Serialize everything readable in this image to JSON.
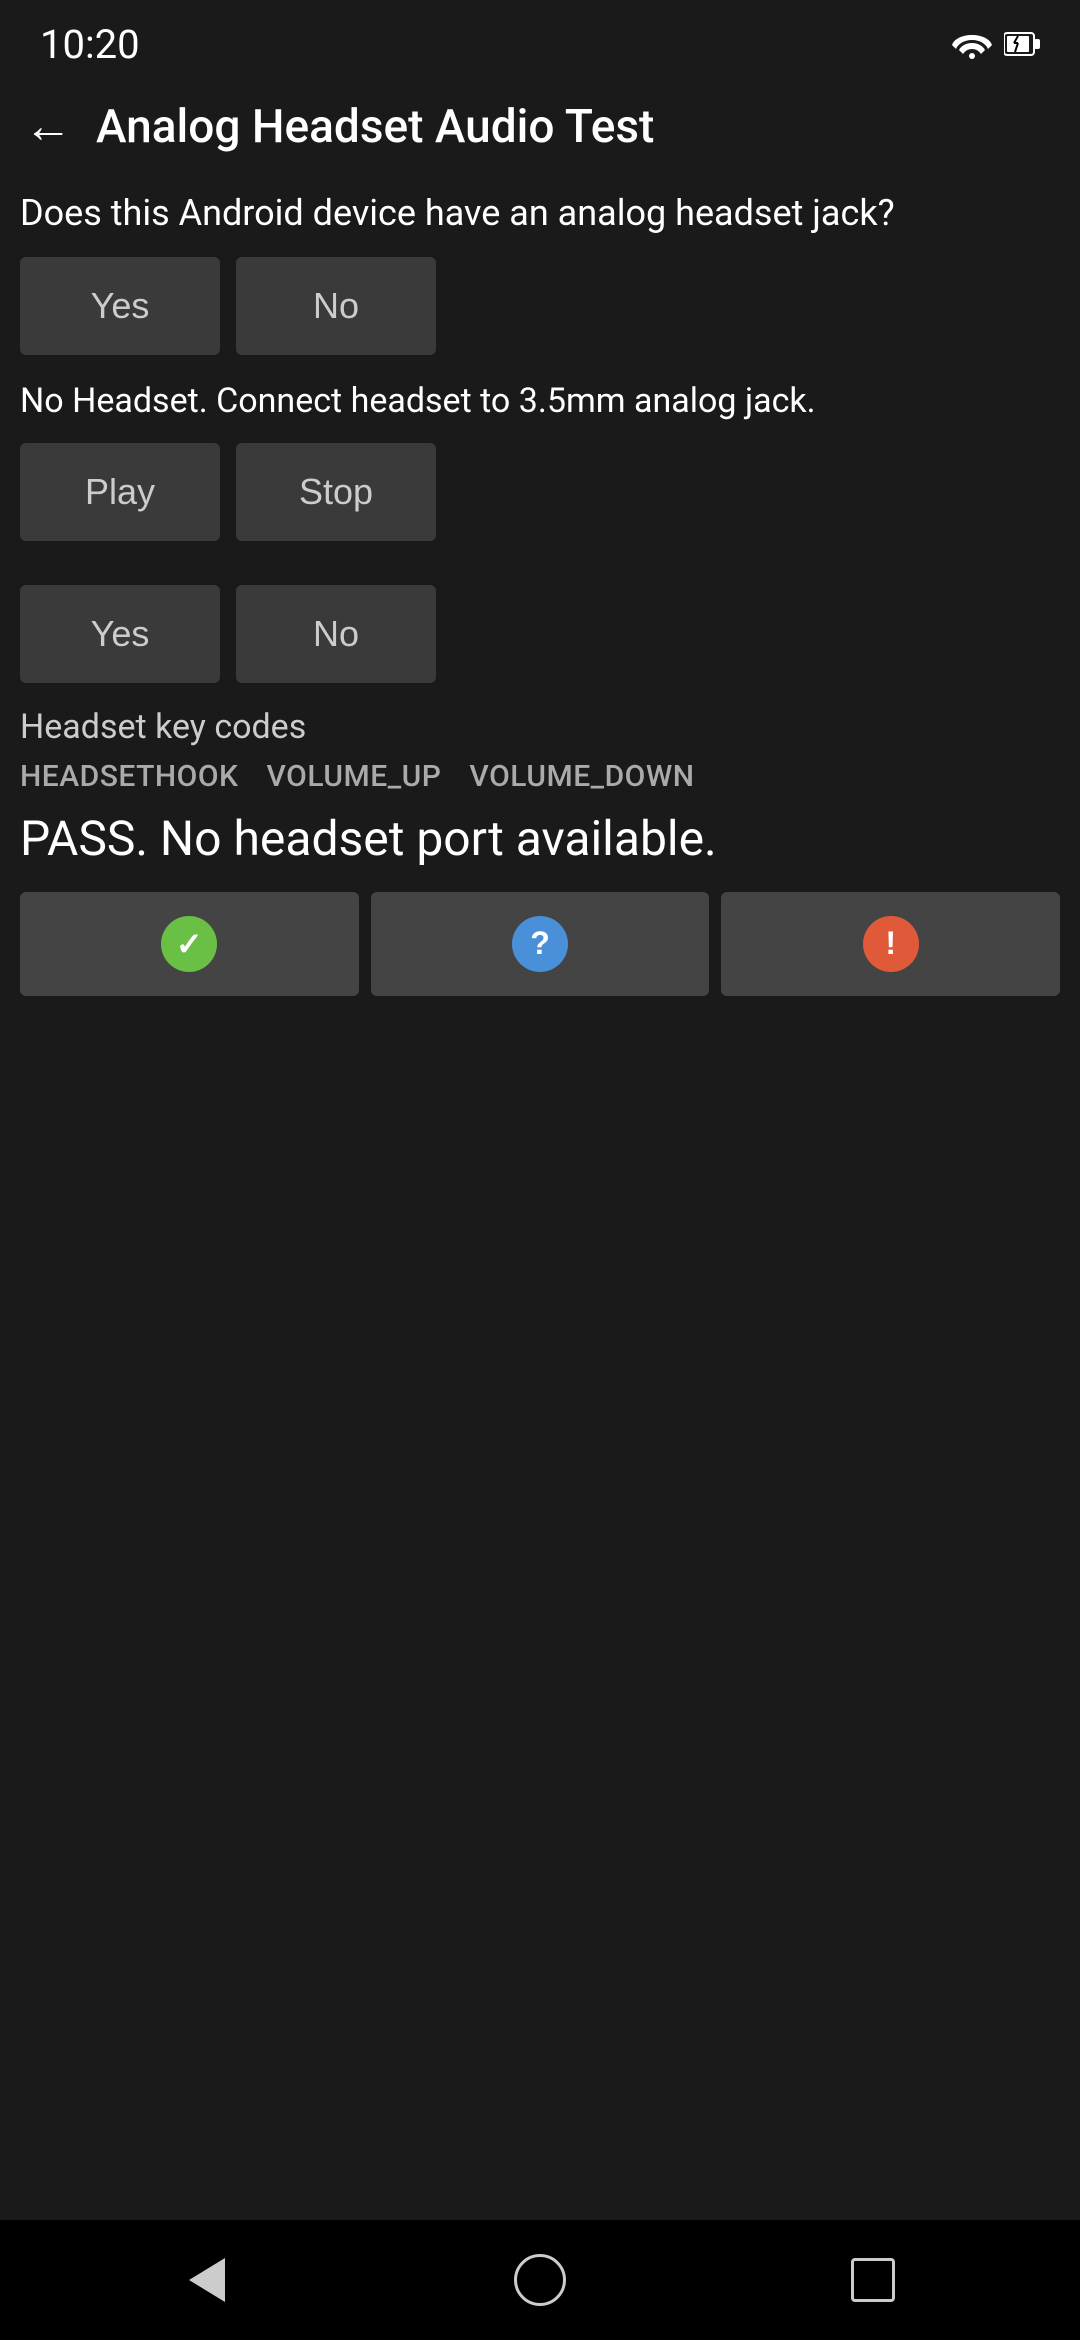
{
  "statusBar": {
    "time": "10:20"
  },
  "appBar": {
    "backLabel": "←",
    "title": "Analog Headset Audio Test"
  },
  "content": {
    "questionText": "Does this Android device have an analog headset jack?",
    "yesButtonLabel1": "Yes",
    "noButtonLabel1": "No",
    "infoText": "No Headset. Connect headset to 3.5mm analog jack.",
    "playButtonLabel": "Play",
    "stopButtonLabel": "Stop",
    "yesButtonLabel2": "Yes",
    "noButtonLabel2": "No",
    "keyCodesLabel": "Headset key codes",
    "keyCodes": [
      "HEADSETHOOK",
      "VOLUME_UP",
      "VOLUME_DOWN"
    ],
    "passText": "PASS. No headset port available."
  },
  "resultButtons": {
    "passIcon": "✓",
    "questionIcon": "?",
    "alertIcon": "!"
  }
}
